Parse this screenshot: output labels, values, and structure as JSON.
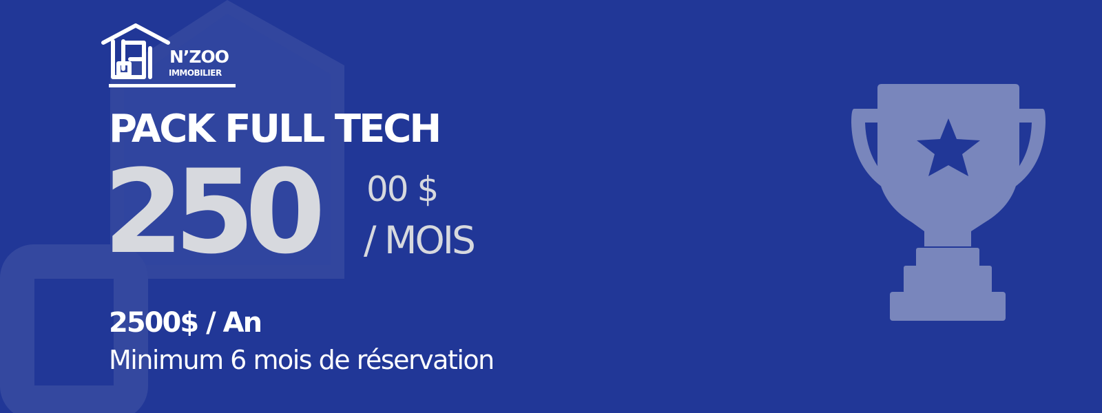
{
  "brand": {
    "name": "N’ZOO",
    "subtitle": "IMMOBILIER"
  },
  "plan": {
    "title": "PACK FULL TECH",
    "price_main": "250",
    "price_cents": "00 $",
    "price_period": "/ MOIS",
    "annual_price": "2500$ / An",
    "note": "Minimum 6 mois de réservation"
  },
  "colors": {
    "background": "#213797",
    "price_text": "#d7d9de",
    "trophy": "#7986bc",
    "decor_house": "#3a4b9f"
  },
  "icons": {
    "logo": "house-logo-icon",
    "trophy": "trophy-star-icon"
  }
}
